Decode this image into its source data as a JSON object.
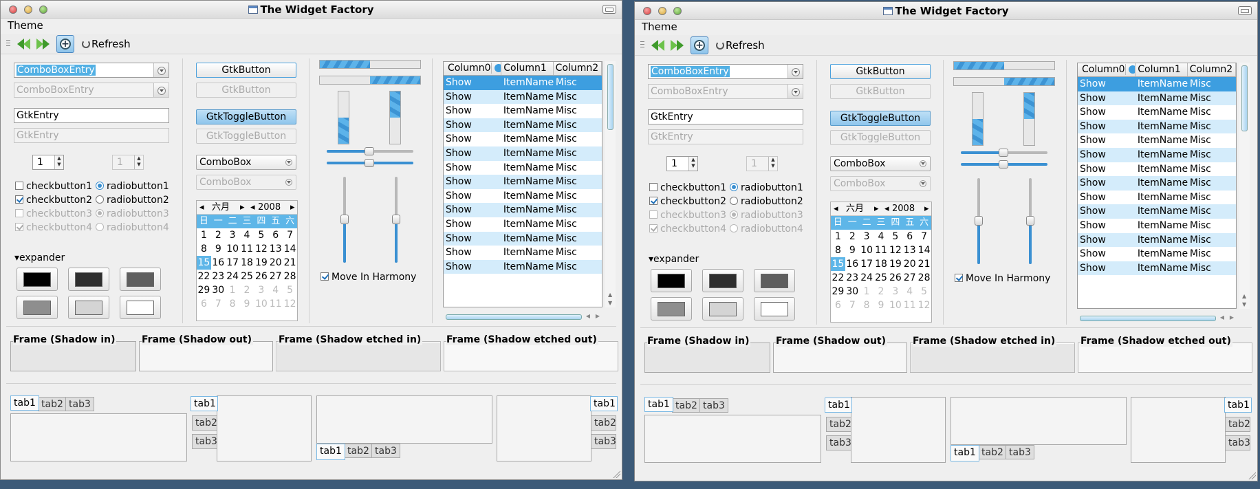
{
  "window": {
    "title": "The Widget Factory"
  },
  "menubar": {
    "theme": "Theme"
  },
  "toolbar": {
    "refresh": "Refresh"
  },
  "entries": {
    "combo_entry": "ComboBoxEntry",
    "combo_entry_disabled": "ComboBoxEntry",
    "gtk_entry": "GtkEntry",
    "gtk_entry_disabled": "GtkEntry"
  },
  "spin": {
    "value": "1",
    "disabled_value": "1"
  },
  "checks": {
    "checkbutton1": "checkbutton1",
    "checkbutton2": "checkbutton2",
    "checkbutton3": "checkbutton3",
    "checkbutton4": "checkbutton4"
  },
  "radios": {
    "radiobutton1": "radiobutton1",
    "radiobutton2": "radiobutton2",
    "radiobutton3": "radiobutton3",
    "radiobutton4": "radiobutton4"
  },
  "expander": {
    "label": "▾expander"
  },
  "swatch_colors": [
    "#000000",
    "#2e2e2e",
    "#5e5e5e",
    "#8e8e8e",
    "#d4d4d4",
    "#ffffff"
  ],
  "buttons": {
    "gtk_button": "GtkButton",
    "gtk_button_disabled": "GtkButton",
    "toggle": "GtkToggleButton",
    "toggle_disabled": "GtkToggleButton",
    "combobox": "ComboBox",
    "combobox_disabled": "ComboBox"
  },
  "calendar": {
    "month": "六月",
    "year": "2008",
    "weekdays": [
      "日",
      "一",
      "二",
      "三",
      "四",
      "五",
      "六"
    ],
    "days": [
      "1",
      "2",
      "3",
      "4",
      "5",
      "6",
      "7",
      "8",
      "9",
      "10",
      "11",
      "12",
      "13",
      "14",
      "15",
      "16",
      "17",
      "18",
      "19",
      "20",
      "21",
      "22",
      "23",
      "24",
      "25",
      "26",
      "27",
      "28",
      "29",
      "30",
      "1",
      "2",
      "3",
      "4",
      "5",
      "6",
      "7",
      "8",
      "9",
      "10",
      "11",
      "12"
    ],
    "today": "15"
  },
  "progress": {
    "h1": 0.5,
    "h2": 0.5,
    "v1": 0.5,
    "v2": 0.5
  },
  "harmony": {
    "label": "Move In Harmony"
  },
  "treeview": {
    "columns": [
      "Column0",
      "Column1",
      "Column2"
    ],
    "rows": [
      [
        "Show",
        "ItemName",
        "Misc"
      ],
      [
        "Show",
        "ItemName",
        "Misc"
      ],
      [
        "Show",
        "ItemName",
        "Misc"
      ],
      [
        "Show",
        "ItemName",
        "Misc"
      ],
      [
        "Show",
        "ItemName",
        "Misc"
      ],
      [
        "Show",
        "ItemName",
        "Misc"
      ],
      [
        "Show",
        "ItemName",
        "Misc"
      ],
      [
        "Show",
        "ItemName",
        "Misc"
      ],
      [
        "Show",
        "ItemName",
        "Misc"
      ],
      [
        "Show",
        "ItemName",
        "Misc"
      ],
      [
        "Show",
        "ItemName",
        "Misc"
      ],
      [
        "Show",
        "ItemName",
        "Misc"
      ],
      [
        "Show",
        "ItemName",
        "Misc"
      ],
      [
        "Show",
        "ItemName",
        "Misc"
      ]
    ]
  },
  "frames": {
    "shadow_in": "Frame (Shadow in)",
    "shadow_out": "Frame (Shadow out)",
    "etched_in": "Frame (Shadow etched in)",
    "etched_out": "Frame (Shadow etched out)"
  },
  "tabs": [
    "tab1",
    "tab2",
    "tab3"
  ]
}
